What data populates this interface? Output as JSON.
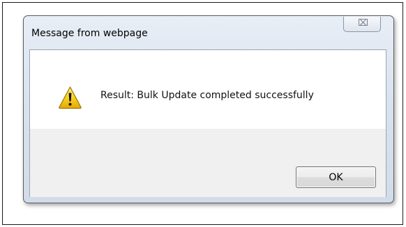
{
  "dialog": {
    "title": "Message from webpage",
    "close_glyph": "⌧",
    "message": "Result: Bulk Update completed successfully",
    "icon": "warning-icon",
    "ok_label": "OK"
  },
  "colors": {
    "warning_yellow": "#f5c400",
    "frame_chrome": "#d9e2ee",
    "button_area": "#f0f0f0"
  }
}
